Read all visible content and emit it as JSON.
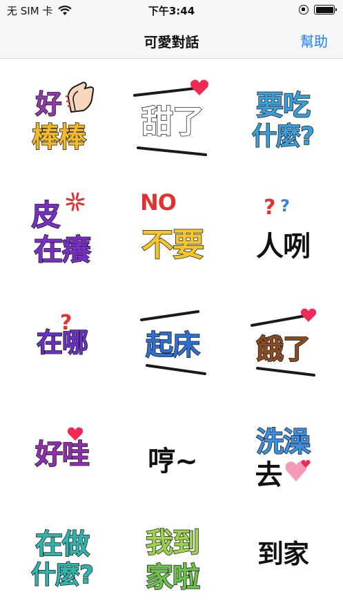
{
  "status_bar": {
    "carrier": "无 SIM 卡",
    "time": "下午3:44",
    "icons": [
      "wifi-icon",
      "orientation-lock-icon",
      "battery-icon"
    ]
  },
  "nav": {
    "title": "可愛對話",
    "help_label": "幫助"
  },
  "colors": {
    "accent": "#1a7ff5",
    "heart": "#ee2a55"
  },
  "stickers": [
    {
      "id": "good-job",
      "lines": [
        "好",
        "棒棒"
      ],
      "decoration": "clapping-hands-icon"
    },
    {
      "id": "so-sweet",
      "lines": [
        "甜了"
      ],
      "decoration": "heart-icon"
    },
    {
      "id": "what-to-eat",
      "lines": [
        "要吃",
        "什麼?"
      ],
      "decoration": ""
    },
    {
      "id": "itching-for-trouble",
      "lines": [
        "皮",
        "在癢"
      ],
      "decoration": "anger-mark-icon"
    },
    {
      "id": "no-dont-want",
      "lines": [
        "NO",
        "不要"
      ],
      "decoration": ""
    },
    {
      "id": "where-are-you-person",
      "lines": [
        "人咧"
      ],
      "decoration": "question-mark-icon"
    },
    {
      "id": "where-are-you",
      "lines": [
        "在哪"
      ],
      "decoration": "question-mark-icon"
    },
    {
      "id": "get-up",
      "lines": [
        "起床"
      ],
      "decoration": ""
    },
    {
      "id": "hungry",
      "lines": [
        "餓了"
      ],
      "decoration": "heart-icon"
    },
    {
      "id": "nice",
      "lines": [
        "好哇"
      ],
      "decoration": "heart-icon"
    },
    {
      "id": "hmph",
      "lines": [
        "哼~"
      ],
      "decoration": ""
    },
    {
      "id": "go-shower",
      "lines": [
        "洗澡",
        "去"
      ],
      "decoration": "heart-icon"
    },
    {
      "id": "what-are-you-doing",
      "lines": [
        "在做",
        "什麼?"
      ],
      "decoration": ""
    },
    {
      "id": "im-home",
      "lines": [
        "我到",
        "家啦"
      ],
      "decoration": ""
    },
    {
      "id": "arrived-home",
      "lines": [
        "到家"
      ],
      "decoration": ""
    }
  ]
}
